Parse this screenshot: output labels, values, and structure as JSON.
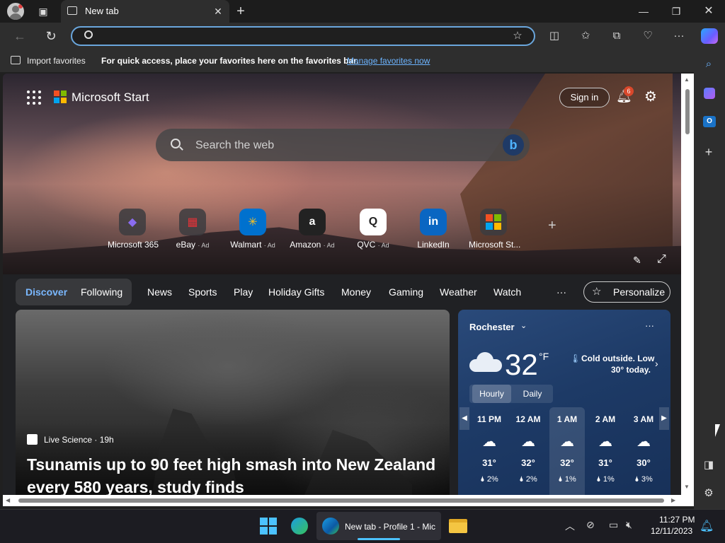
{
  "browser": {
    "tab_title": "New tab",
    "favorites_bar": {
      "import_label": "Import favorites",
      "hint": "For quick access, place your favorites here on the favorites bar.",
      "manage_link": "Manage favorites now"
    }
  },
  "start": {
    "brand": "Microsoft Start",
    "sign_in": "Sign in",
    "notification_count": "6",
    "search_placeholder": "Search the web",
    "quick_links": [
      {
        "label": "Microsoft 365",
        "ad": "",
        "glyph": "◆",
        "color": "#8a6cf0"
      },
      {
        "label": "eBay",
        "ad": "· Ad",
        "glyph": "▦",
        "color": "#e53238"
      },
      {
        "label": "Walmart",
        "ad": "· Ad",
        "glyph": "✳",
        "color": "#ffc220"
      },
      {
        "label": "Amazon",
        "ad": "· Ad",
        "glyph": "a",
        "color": "#ffffff"
      },
      {
        "label": "QVC",
        "ad": "· Ad",
        "glyph": "Q",
        "color": "#ffffff"
      },
      {
        "label": "LinkedIn",
        "ad": "",
        "glyph": "in",
        "color": "#ffffff"
      },
      {
        "label": "Microsoft St...",
        "ad": "",
        "glyph": "",
        "color": "#ffffff"
      }
    ],
    "nav": {
      "discover": "Discover",
      "following": "Following",
      "items": [
        "News",
        "Sports",
        "Play",
        "Holiday Gifts",
        "Money",
        "Gaming",
        "Weather",
        "Watch"
      ],
      "more": "···",
      "personalize": "Personalize"
    },
    "news": {
      "source": "Live Science · 19h",
      "headline_line1": "Tsunamis up to 90 feet high smash into New Zealand",
      "headline_line2": "every 580 years, study finds"
    },
    "weather": {
      "city": "Rochester",
      "temp": "32",
      "unit": "°F",
      "summary_line1": "Cold outside. Low",
      "summary_line2": "30° today.",
      "tab_hourly": "Hourly",
      "tab_daily": "Daily",
      "hours": [
        {
          "time": "11 PM",
          "temp": "31°",
          "precip": "2%"
        },
        {
          "time": "12 AM",
          "temp": "32°",
          "precip": "2%"
        },
        {
          "time": "1 AM",
          "temp": "32°",
          "precip": "1%"
        },
        {
          "time": "2 AM",
          "temp": "31°",
          "precip": "1%"
        },
        {
          "time": "3 AM",
          "temp": "30°",
          "precip": "3%"
        }
      ]
    }
  },
  "taskbar": {
    "edge_window_label": "New tab - Profile 1 - Mic",
    "time": "11:27 PM",
    "date": "12/11/2023"
  }
}
